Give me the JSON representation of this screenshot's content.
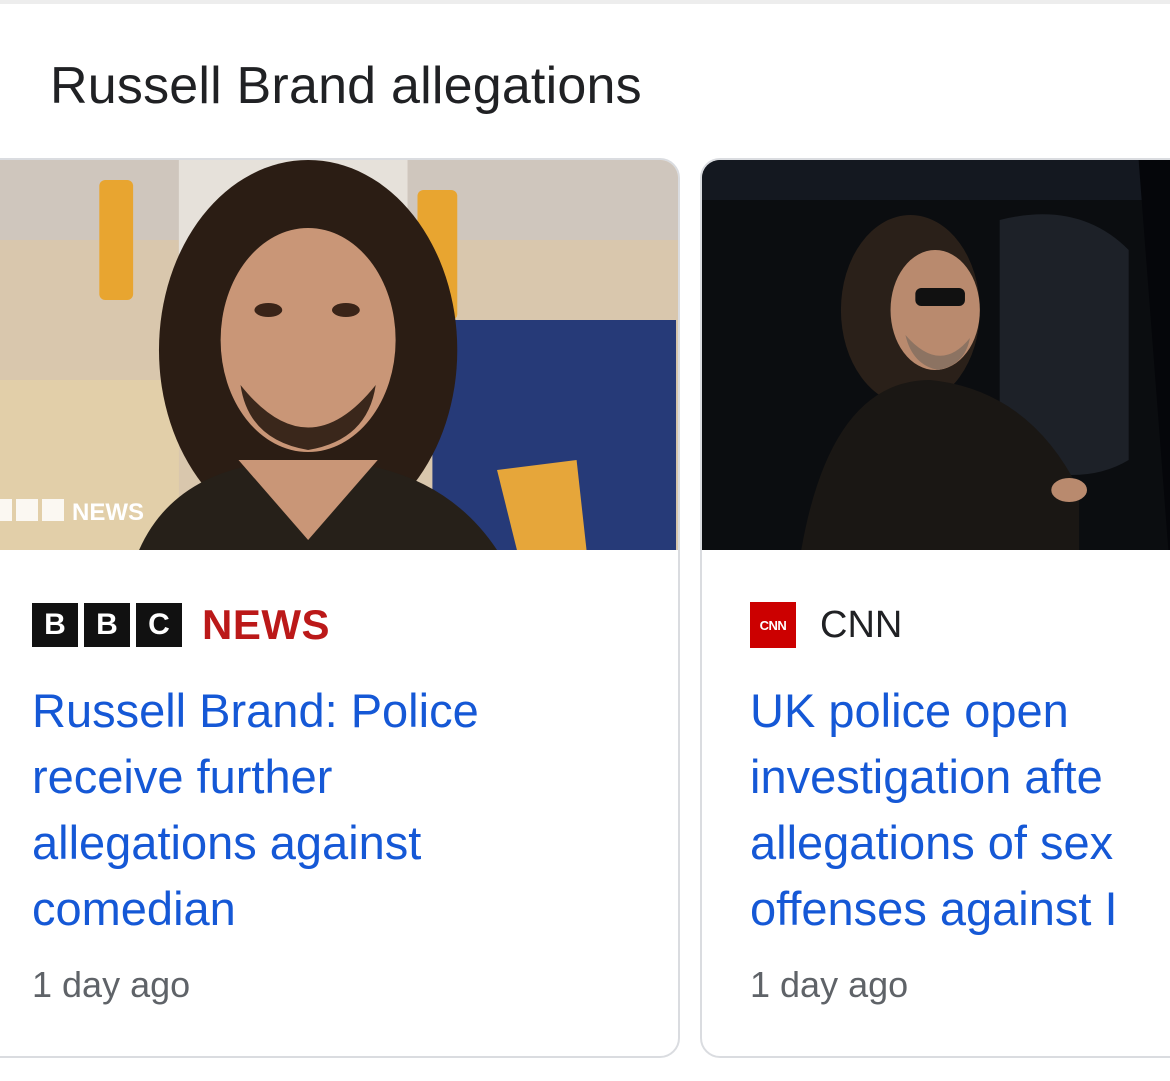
{
  "section": {
    "title": "Russell Brand allegations"
  },
  "cards": [
    {
      "image_watermark": "NEWS",
      "source": {
        "logo_letters": [
          "B",
          "B",
          "C"
        ],
        "logo_word": "NEWS",
        "icon": "bbc-news-logo"
      },
      "headline_lines": [
        "Russell Brand: Police",
        "receive further",
        "allegations against",
        "comedian"
      ],
      "timestamp": "1 day ago"
    },
    {
      "source": {
        "name": "CNN",
        "favicon_text": "CNN",
        "icon": "cnn-favicon"
      },
      "headline_lines": [
        "UK police open",
        "investigation afte",
        "allegations of sex",
        "offenses against I"
      ],
      "timestamp": "1 day ago"
    }
  ],
  "colors": {
    "headline_link": "#1558d6",
    "bbc_red": "#bb1919",
    "cnn_red": "#cc0000",
    "meta_gray": "#5f6368",
    "card_border": "#dadce0"
  }
}
